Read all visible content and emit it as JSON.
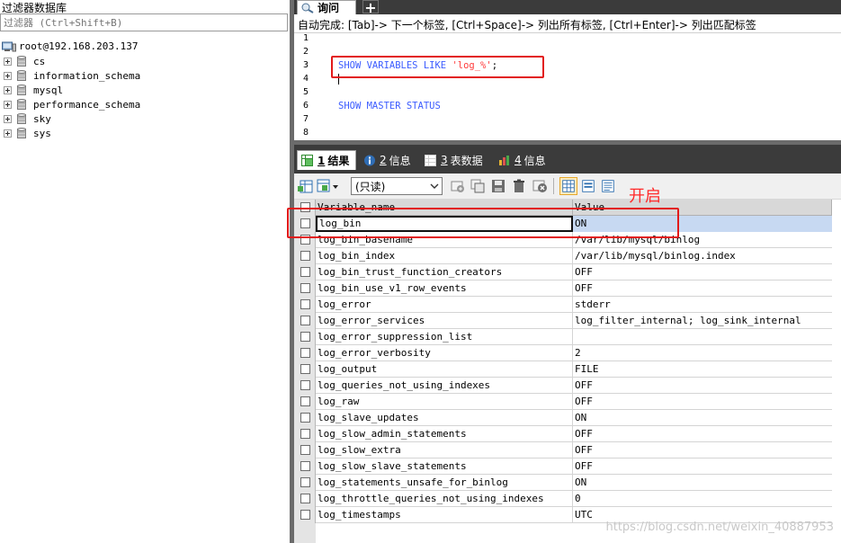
{
  "left_panel": {
    "filter_title": "过滤器数据库",
    "filter_placeholder": "过滤器 (Ctrl+Shift+B)",
    "connection": "root@192.168.203.137",
    "databases": [
      "cs",
      "information_schema",
      "mysql",
      "performance_schema",
      "sky",
      "sys"
    ]
  },
  "query_tab": {
    "label": "询问",
    "add_label": "+"
  },
  "editor": {
    "autocomplete_hint": "自动完成: [Tab]-> 下一个标签, [Ctrl+Space]-> 列出所有标签, [Ctrl+Enter]-> 列出匹配标签",
    "line_numbers": [
      "1",
      "2",
      "3",
      "4",
      "5",
      "6",
      "7",
      "8"
    ],
    "line3_keyword": "SHOW VARIABLES LIKE ",
    "line3_string": "'log_%'",
    "line3_semicolon": ";",
    "line6": "SHOW MASTER STATUS"
  },
  "result_tabs": [
    {
      "num": "1",
      "label": "结果",
      "active": true
    },
    {
      "num": "2",
      "label": "信息",
      "active": false
    },
    {
      "num": "3",
      "label": "表数据",
      "active": false
    },
    {
      "num": "4",
      "label": "信息",
      "active": false
    }
  ],
  "toolbar": {
    "readonly_option": "(只读)"
  },
  "annotation": {
    "label": "开启"
  },
  "grid": {
    "columns": [
      "Variable_name",
      "Value"
    ],
    "rows": [
      [
        "log_bin",
        "ON"
      ],
      [
        "log_bin_basename",
        "/var/lib/mysql/binlog"
      ],
      [
        "log_bin_index",
        "/var/lib/mysql/binlog.index"
      ],
      [
        "log_bin_trust_function_creators",
        "OFF"
      ],
      [
        "log_bin_use_v1_row_events",
        "OFF"
      ],
      [
        "log_error",
        "stderr"
      ],
      [
        "log_error_services",
        "log_filter_internal; log_sink_internal"
      ],
      [
        "log_error_suppression_list",
        ""
      ],
      [
        "log_error_verbosity",
        "2"
      ],
      [
        "log_output",
        "FILE"
      ],
      [
        "log_queries_not_using_indexes",
        "OFF"
      ],
      [
        "log_raw",
        "OFF"
      ],
      [
        "log_slave_updates",
        "ON"
      ],
      [
        "log_slow_admin_statements",
        "OFF"
      ],
      [
        "log_slow_extra",
        "OFF"
      ],
      [
        "log_slow_slave_statements",
        "OFF"
      ],
      [
        "log_statements_unsafe_for_binlog",
        "ON"
      ],
      [
        "log_throttle_queries_not_using_indexes",
        "0"
      ],
      [
        "log_timestamps",
        "UTC"
      ]
    ],
    "selected_row": 0
  },
  "watermark": "https://blog.csdn.net/weixin_40887953",
  "colors": {
    "keyword": "#3c5cff",
    "string": "#ff3b3b",
    "annotation_red": "#e21a1a",
    "selected_cell": "#c7d9f2",
    "tabbar_dark": "#3b3b3b"
  }
}
